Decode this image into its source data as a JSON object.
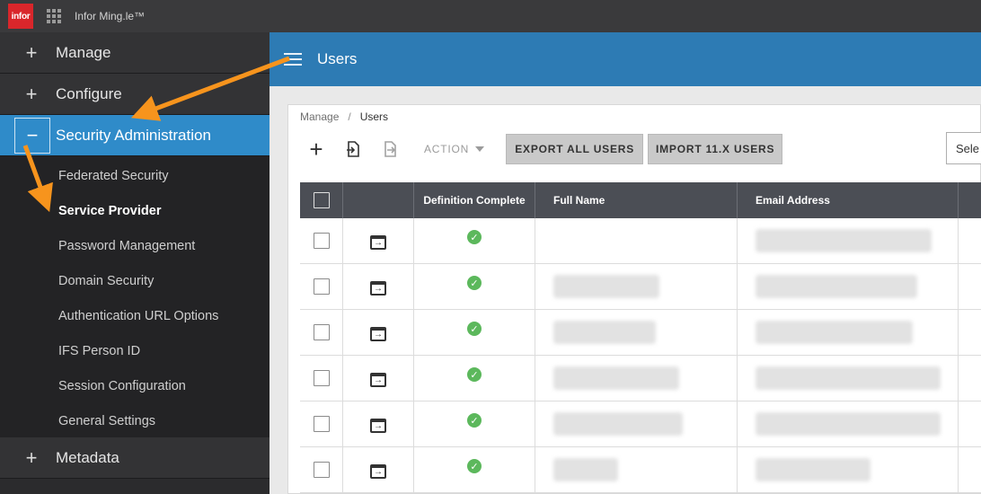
{
  "topbar": {
    "logo": "infor",
    "app_title": "Infor Ming.le™"
  },
  "sidebar": {
    "manage": {
      "label": "Manage",
      "icon": "+"
    },
    "configure": {
      "label": "Configure",
      "icon": "+"
    },
    "security_admin": {
      "label": "Security Administration",
      "icon": "−"
    },
    "sub_items": [
      "Federated Security",
      "Service Provider",
      "Password Management",
      "Domain Security",
      "Authentication URL Options",
      "IFS Person ID",
      "Session Configuration",
      "General Settings"
    ],
    "metadata": {
      "label": "Metadata",
      "icon": "+"
    }
  },
  "header": {
    "title": "Users"
  },
  "breadcrumb": {
    "root": "Manage",
    "separator": "/",
    "current": "Users"
  },
  "toolbar": {
    "action_label": "ACTION",
    "export_label": "EXPORT ALL USERS",
    "import_label": "IMPORT 11.X USERS",
    "select_placeholder": "Sele"
  },
  "table": {
    "columns": [
      "Definition Complete",
      "Full Name",
      "Email Address"
    ],
    "rows": [
      {
        "complete": true,
        "name_blur": 0,
        "email_blur": 196
      },
      {
        "complete": true,
        "name_blur": 118,
        "email_blur": 180
      },
      {
        "complete": true,
        "name_blur": 114,
        "email_blur": 175
      },
      {
        "complete": true,
        "name_blur": 140,
        "email_blur": 206
      },
      {
        "complete": true,
        "name_blur": 144,
        "email_blur": 206
      },
      {
        "complete": true,
        "name_blur": 72,
        "email_blur": 128
      }
    ]
  },
  "colors": {
    "accent": "#2f8bc9",
    "header": "#2d7bb4",
    "annotation": "#f7941d",
    "check": "#5cb85c"
  }
}
